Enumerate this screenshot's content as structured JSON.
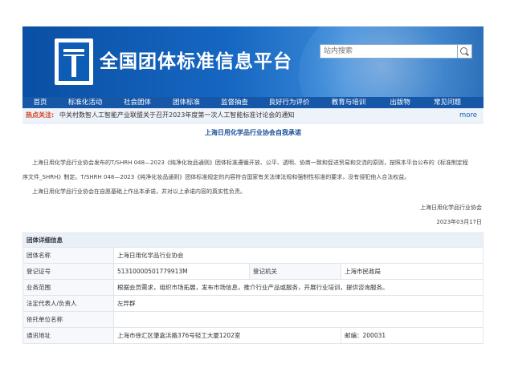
{
  "header": {
    "site_title": "全国团体标准信息平台",
    "search_placeholder": "站内搜索"
  },
  "nav": {
    "items": [
      "首页",
      "标准化活动",
      "社会团体",
      "团体标准",
      "监督抽查",
      "良好行为评价",
      "教育与培训",
      "出版物",
      "常见问题"
    ]
  },
  "ticker": {
    "label": "热点关注:",
    "text": "中关村数智人工智能产业联盟关于召开2023年度第一次人工智能标准讨论会的通知",
    "more": "more"
  },
  "article": {
    "title": "上海日用化学品行业协会自我承诺",
    "para1_line1": "上海日用化学品行业协会发布的T/SHRH 048—2023《纯净化妆品通则》团体标准遵循开放、公平、透明、协商一致和促进贸易和交流的原则，按照本平台公布的《标准制定程",
    "para1_line2": "序文件_SHRH》制定。T/SHRH 048—2023《纯净化妆品通则》团体标准规定的内容符合国家有关法律法规和强制性标准的要求，没有侵犯他人合法权益。",
    "para2": "上海日用化学品行业协会在自愿基础上作出本承诺，并对以上承诺内容的真实性负责。",
    "signature": "上海日用化学品行业协会",
    "date": "2023年03月17日"
  },
  "details": {
    "heading": "团体详细信息",
    "org_name_label": "团体名称",
    "org_name": "上海日用化学品行业协会",
    "reg_no_label": "登记证号",
    "reg_no": "51310000501779913M",
    "reg_authority_label": "登记机关",
    "reg_authority": "上海市民政局",
    "scope_label": "业务范围",
    "scope": "根据会员需求，组织市场拓展，发布市场信息，推介行业产品或服务，开展行业培训，提供咨询服务。",
    "legal_rep_label": "法定代表人/负责人",
    "legal_rep": "左异群",
    "sponsor_label": "依托单位名称",
    "sponsor": "",
    "address_label": "通讯地址",
    "address": "上海市徐汇区肇嘉浜路376号轻工大厦1202室",
    "postcode": "邮编：200031"
  }
}
